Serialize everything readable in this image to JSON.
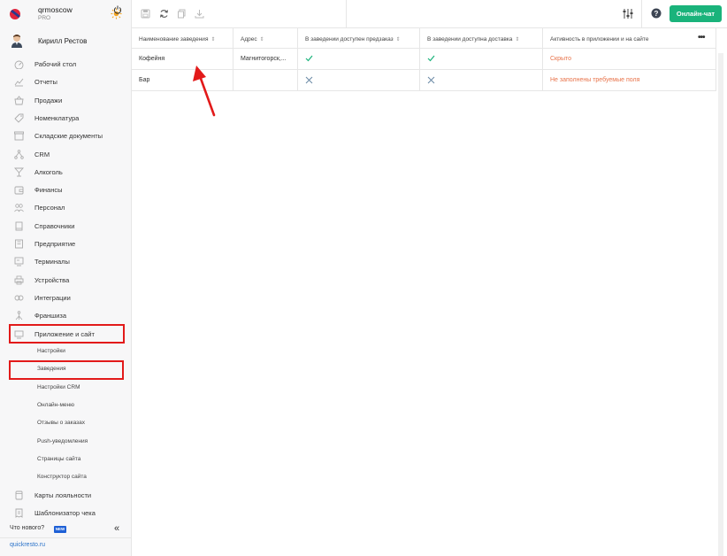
{
  "brand": {
    "name": "qrmoscow",
    "tier": "PRO"
  },
  "user": {
    "name": "Кирилл Рестов"
  },
  "nav": {
    "items": [
      {
        "label": "Рабочий стол",
        "icon": "gauge-icon"
      },
      {
        "label": "Отчеты",
        "icon": "chart-icon"
      },
      {
        "label": "Продажи",
        "icon": "basket-icon"
      },
      {
        "label": "Номенклатура",
        "icon": "tag-icon"
      },
      {
        "label": "Складские документы",
        "icon": "box-icon"
      },
      {
        "label": "CRM",
        "icon": "network-icon"
      },
      {
        "label": "Алкоголь",
        "icon": "glass-icon"
      },
      {
        "label": "Финансы",
        "icon": "wallet-icon"
      },
      {
        "label": "Персонал",
        "icon": "people-icon"
      },
      {
        "label": "Справочники",
        "icon": "book-icon"
      },
      {
        "label": "Предприятие",
        "icon": "building-icon"
      },
      {
        "label": "Терминалы",
        "icon": "terminal-icon"
      },
      {
        "label": "Устройства",
        "icon": "printer-icon"
      },
      {
        "label": "Интеграции",
        "icon": "link-icon"
      },
      {
        "label": "Франшиза",
        "icon": "franchise-icon"
      },
      {
        "label": "Приложение и сайт",
        "icon": "monitor-icon"
      }
    ],
    "sub_items": [
      {
        "label": "Настройки"
      },
      {
        "label": "Заведения"
      },
      {
        "label": "Настройки CRM"
      },
      {
        "label": "Онлайн-меню"
      },
      {
        "label": "Отзывы о заказах"
      },
      {
        "label": "Push-уведомления"
      },
      {
        "label": "Страницы сайта"
      },
      {
        "label": "Конструктор сайта"
      }
    ],
    "bottom_items": [
      {
        "label": "Карты лояльности",
        "icon": "card-icon"
      },
      {
        "label": "Шаблонизатор чека",
        "icon": "receipt-icon"
      }
    ]
  },
  "footer": {
    "whats_new": "Что нового?",
    "new_badge": "NEW",
    "collapse": "«",
    "site": "quickresto.ru"
  },
  "toolbar": {
    "chat_label": "Онлайн-чат"
  },
  "table": {
    "headers": [
      "Наименование заведения",
      "Адрес",
      "В заведении доступен предзаказ",
      "В заведении доступна доставка",
      "Активность в приложении и на сайте"
    ],
    "rows": [
      {
        "name": "Кофейня",
        "address": "Магнитогорск,...",
        "preorder": "check",
        "delivery": "check",
        "status": "Скрыто"
      },
      {
        "name": "Бар",
        "address": "",
        "preorder": "cross",
        "delivery": "cross",
        "status": "Не заполнены требуемые поля"
      }
    ],
    "more": "•••"
  },
  "colors": {
    "accent": "#1ab37b",
    "highlight": "#e21a1a",
    "warning": "#e8734a",
    "link": "#2a72c9"
  }
}
